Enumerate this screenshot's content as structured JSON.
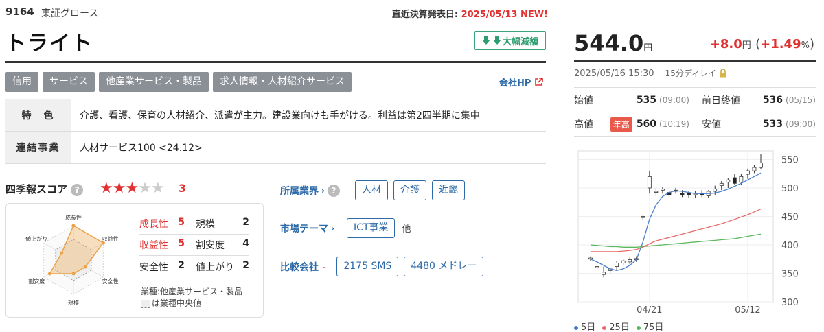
{
  "header": {
    "code": "9164",
    "market": "東証グロース",
    "settlement_label": "直近決算発表日:",
    "settlement_date": "2025/05/13",
    "settlement_new": "NEW!",
    "company_name": "トライト",
    "badge": "大幅減額",
    "badge_icon": "double-down-arrow"
  },
  "tags": [
    "信用",
    "サービス",
    "他産業サービス・製品",
    "求人情報・人材紹介サービス"
  ],
  "company_hp": "会社HP",
  "info": {
    "feature_label": "特　色",
    "feature_value": "介護、看護、保育の人材紹介、派遣が主力。建設業向けも手がける。利益は第2四半期に集中",
    "segment_label": "連結事業",
    "segment_value": "人材サービス100 <24.12>"
  },
  "score": {
    "title": "四季報スコア",
    "help": "?",
    "stars_total": 5,
    "stars_on": 3,
    "value": "3",
    "rows": [
      {
        "l_label": "成長性",
        "l_value": "5",
        "l_red": true,
        "r_label": "規模",
        "r_value": "2"
      },
      {
        "l_label": "収益性",
        "l_value": "5",
        "l_red": true,
        "r_label": "割安度",
        "r_value": "4"
      },
      {
        "l_label": "安全性",
        "l_value": "2",
        "l_red": false,
        "r_label": "値上がり",
        "r_value": "2"
      }
    ],
    "industry_note": "業種:他産業サービス・製品",
    "industry_legend": "は業種中央値",
    "radar_labels": [
      "成長性",
      "収益性",
      "安全性",
      "規模",
      "割安度",
      "値上がり"
    ],
    "radar_company": [
      5,
      5,
      2,
      2,
      4,
      2
    ],
    "radar_industry": [
      3,
      3,
      3,
      3,
      3,
      3
    ]
  },
  "sections": {
    "industry_label": "所属業界",
    "industry_chips": [
      "人材",
      "介護",
      "近畿"
    ],
    "theme_label": "市場テーマ",
    "theme_chips": [
      "ICT事業"
    ],
    "theme_other": "他",
    "compare_label": "比較会社",
    "compare_chips": [
      "2175 SMS",
      "4480 メドレー"
    ]
  },
  "quote": {
    "price": "544.0",
    "price_unit": "円",
    "change": "+8.0",
    "change_unit": "円",
    "change_pct": "+1.49",
    "change_pct_unit": "%",
    "timestamp": "2025/05/16 15:30",
    "delay": "15分ディレイ",
    "open_label": "始値",
    "open": "535",
    "open_time": "(09:00)",
    "prev_label": "前日終値",
    "prev": "536",
    "prev_time": "(05/15)",
    "high_label": "高値",
    "high_badge": "年高",
    "high": "560",
    "high_time": "(10:19)",
    "low_label": "安値",
    "low": "533",
    "low_time": "(09:00)"
  },
  "colors": {
    "red": "#e03030",
    "blue": "#2d6aa8",
    "green_badge": "#2d9c6e",
    "ma5": "#4a7fd0",
    "ma25": "#e86a6a",
    "ma75": "#5cb85c"
  },
  "chart_data": {
    "type": "candlestick",
    "y_ticks": [
      "550",
      "500",
      "450",
      "400",
      "350",
      "300"
    ],
    "ylim": [
      300,
      565
    ],
    "x_tick_labels": [
      "04/21",
      "05/12"
    ],
    "legend": [
      {
        "name": "5日",
        "color": "#4a7fd0"
      },
      {
        "name": "25日",
        "color": "#e86a6a"
      },
      {
        "name": "75日",
        "color": "#5cb85c"
      }
    ],
    "candles": [
      [
        375,
        380,
        372,
        377
      ],
      [
        360,
        368,
        355,
        362
      ],
      [
        348,
        362,
        343,
        352
      ],
      [
        355,
        360,
        350,
        358
      ],
      [
        362,
        372,
        356,
        368
      ],
      [
        368,
        375,
        364,
        372
      ],
      [
        370,
        378,
        366,
        374
      ],
      [
        374,
        380,
        370,
        376
      ],
      [
        448,
        452,
        444,
        450
      ],
      [
        500,
        530,
        490,
        520
      ],
      [
        492,
        500,
        486,
        494
      ],
      [
        496,
        502,
        490,
        498
      ],
      [
        492,
        498,
        484,
        488
      ],
      [
        496,
        500,
        490,
        494
      ],
      [
        490,
        496,
        484,
        488
      ],
      [
        490,
        494,
        482,
        488
      ],
      [
        488,
        494,
        482,
        490
      ],
      [
        490,
        496,
        484,
        488
      ],
      [
        486,
        496,
        482,
        494
      ],
      [
        494,
        504,
        488,
        498
      ],
      [
        504,
        512,
        496,
        508
      ],
      [
        510,
        518,
        500,
        514
      ],
      [
        518,
        524,
        506,
        508
      ],
      [
        510,
        524,
        506,
        520
      ],
      [
        524,
        534,
        516,
        530
      ],
      [
        530,
        540,
        526,
        536
      ],
      [
        536,
        560,
        533,
        544
      ]
    ],
    "ma5": [
      375,
      370,
      364,
      358,
      355,
      358,
      364,
      374,
      405,
      445,
      470,
      485,
      492,
      495,
      494,
      492,
      490,
      490,
      490,
      491,
      494,
      498,
      503,
      508,
      514,
      520,
      526
    ],
    "ma25": [
      388,
      388,
      388,
      388,
      388,
      389,
      390,
      392,
      396,
      402,
      407,
      410,
      413,
      416,
      419,
      422,
      425,
      428,
      431,
      434,
      437,
      441,
      445,
      449,
      453,
      458,
      463
    ],
    "ma75": [
      400,
      399,
      398,
      397,
      397,
      396,
      396,
      396,
      397,
      398,
      399,
      400,
      401,
      402,
      403,
      404,
      405,
      406,
      407,
      408,
      409,
      410,
      411,
      413,
      415,
      417,
      419
    ]
  }
}
